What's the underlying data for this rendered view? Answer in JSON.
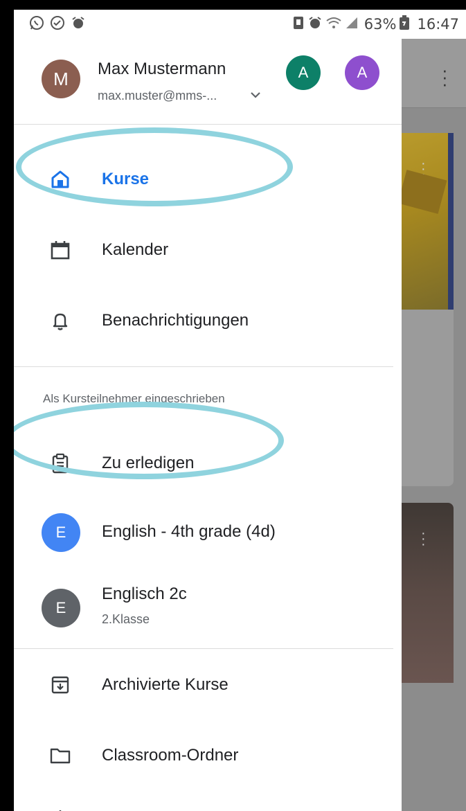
{
  "status_bar": {
    "left_icons": [
      "whatsapp-icon",
      "check-circle-icon",
      "alarm-icon"
    ],
    "right_icons": [
      "battery-saver-icon",
      "alarm-icon",
      "wifi-icon",
      "signal-icon",
      "battery-icon"
    ],
    "battery": "63%",
    "time": "16:47"
  },
  "account": {
    "avatar_letter": "M",
    "name": "Max Mustermann",
    "email": "max.muster@mms-...",
    "other_accounts": [
      "A",
      "A"
    ]
  },
  "nav": {
    "courses": "Kurse",
    "calendar": "Kalender",
    "notifications": "Benachrichtigungen"
  },
  "enrolled_section": {
    "title": "Als Kursteilnehmer eingeschrieben",
    "todo": "Zu erledigen",
    "classes": [
      {
        "letter": "E",
        "title": "English - 4th grade (4d)",
        "subtitle": ""
      },
      {
        "letter": "E",
        "title": "Englisch 2c",
        "subtitle": "2.Klasse"
      }
    ]
  },
  "bottom": {
    "archived": "Archivierte Kurse",
    "folder": "Classroom-Ordner"
  },
  "colors": {
    "active": "#1a73e8",
    "highlight": "#8fd3de",
    "avatar_m": "#8b5e50",
    "avatar_a1": "#0d8068",
    "avatar_a2": "#8e4fce",
    "class_blue": "#4285f4",
    "class_grey": "#5f6368"
  }
}
